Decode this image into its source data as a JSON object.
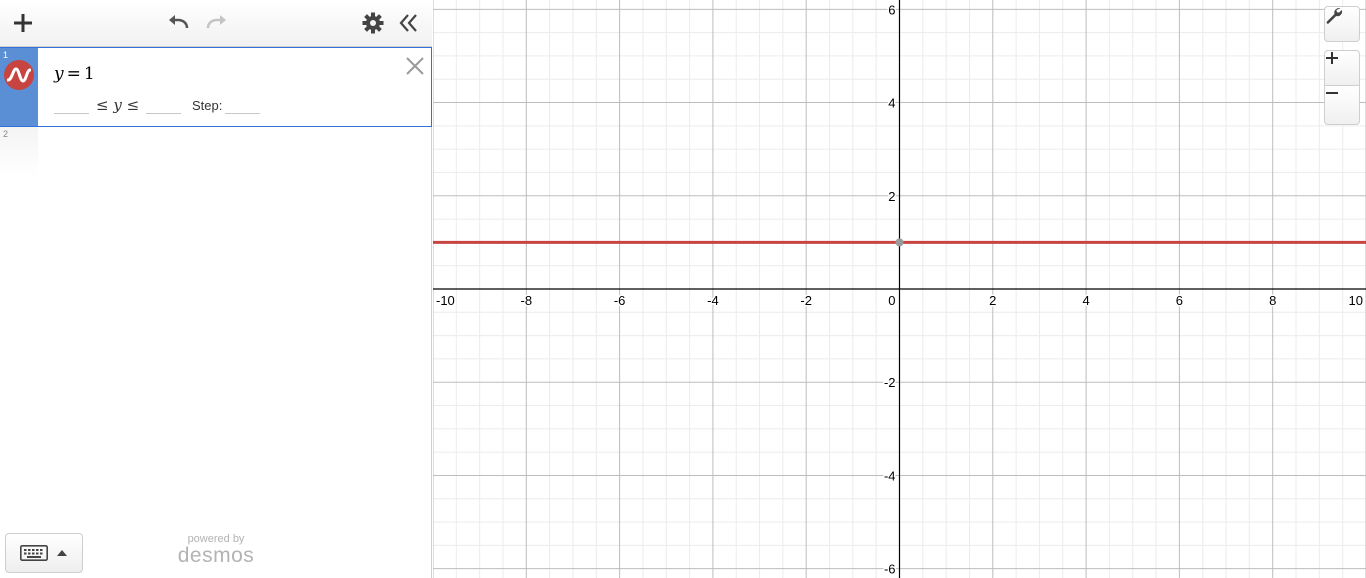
{
  "toolbar": {
    "add_icon": "plus-icon",
    "undo_icon": "undo-icon",
    "redo_icon": "redo-icon",
    "settings_icon": "gear-icon",
    "collapse_icon": "double-chevron-left-icon"
  },
  "expressions": [
    {
      "index": "1",
      "lhs": "y",
      "op": "=",
      "rhs": "1",
      "color": "#c74440",
      "domain": {
        "le1": "≤",
        "var": "y",
        "le2": "≤",
        "step_label": "Step:"
      }
    },
    {
      "index": "2"
    }
  ],
  "keypad_icon": "keyboard-icon",
  "branding": {
    "powered_by": "powered by",
    "name": "desmos"
  },
  "graph": {
    "x_ticks": [
      "-10",
      "-8",
      "-6",
      "-4",
      "-2",
      "0",
      "2",
      "4",
      "6",
      "8",
      "10"
    ],
    "y_ticks": [
      "6",
      "4",
      "2",
      "-2",
      "-4",
      "-6"
    ],
    "xlim": [
      -10,
      10
    ],
    "ylim": [
      -6.2,
      6.2
    ],
    "curve": {
      "type": "horizontal-line",
      "y": 1,
      "color": "#c74440"
    }
  },
  "controls": {
    "wrench_icon": "wrench-icon",
    "zoom_in_label": "+",
    "zoom_out_label": "−"
  }
}
